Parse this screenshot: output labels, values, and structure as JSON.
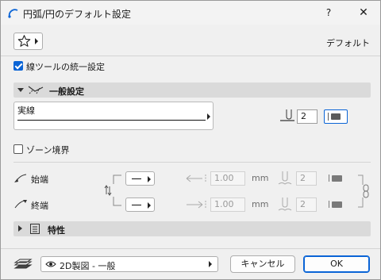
{
  "dialog": {
    "title": "円弧/円のデフォルト設定",
    "help_label": "?",
    "close_label": "✕",
    "default_label": "デフォルト"
  },
  "unified_tool": {
    "label": "線ツールの統一設定",
    "checked": true
  },
  "general_section": {
    "title": "一般設定",
    "expanded": true,
    "line_type_name": "実線",
    "pen_number": "2"
  },
  "zone_boundary": {
    "label": "ゾーン境界",
    "checked": false
  },
  "start": {
    "label": "始端",
    "size": "1.00",
    "unit": "mm",
    "pen": "2"
  },
  "end": {
    "label": "終端",
    "size": "1.00",
    "unit": "mm",
    "pen": "2"
  },
  "properties_section": {
    "title": "特性",
    "expanded": false
  },
  "footer": {
    "layer_value": "2D製図 - 一般",
    "cancel_label": "キャンセル",
    "ok_label": "OK"
  },
  "icons": {
    "title": "arc-tool-icon",
    "favorites": "star-icon",
    "general": "line-settings-icon",
    "properties": "list-icon",
    "layer": "layers-icon",
    "visibility": "eye-icon"
  },
  "colors": {
    "accent": "#0a64d6",
    "section_bar": "#dadada"
  }
}
